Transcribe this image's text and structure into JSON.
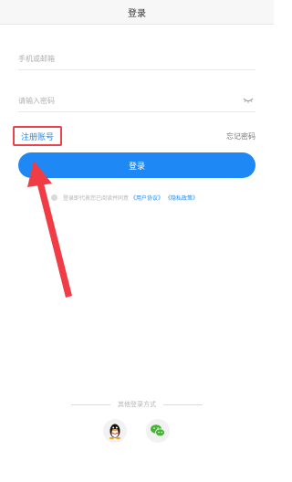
{
  "header": {
    "title": "登录"
  },
  "form": {
    "account_placeholder": "手机或邮箱",
    "password_placeholder": "请输入密码",
    "password_toggle_icon": "eye-off-icon"
  },
  "links": {
    "register_label": "注册账号",
    "forgot_label": "忘记密码"
  },
  "login_button": {
    "label": "登录"
  },
  "agreement": {
    "text": "登录即代表您已阅读并同意",
    "user_agreement": "《用户协议》",
    "privacy_policy": "《隐私政策》"
  },
  "other_login": {
    "label": "其他登录方式",
    "providers": [
      {
        "name": "QQ",
        "icon": "qq-icon"
      },
      {
        "name": "WeChat",
        "icon": "wechat-icon"
      }
    ]
  },
  "colors": {
    "accent": "#1e88f5",
    "highlight": "#e8434e"
  }
}
